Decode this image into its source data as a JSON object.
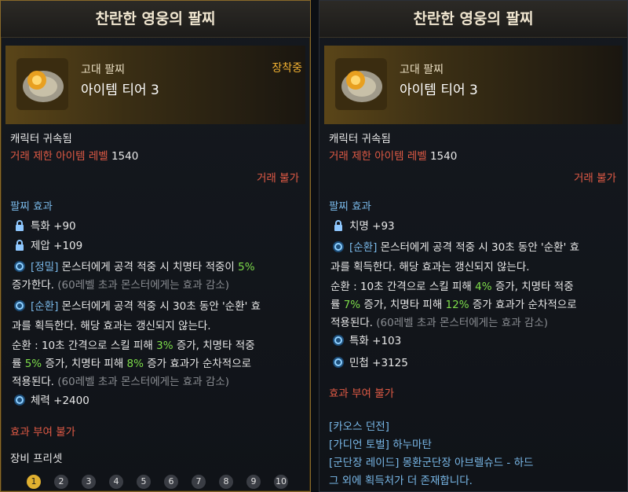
{
  "left": {
    "title": "찬란한 영웅의 팔찌",
    "grade": "고대 팔찌",
    "tier": "아이템 티어 3",
    "equipped": "장착중",
    "bound": "캐릭터 귀속됨",
    "trade_level_label": "거래 제한 아이템 레벨",
    "trade_level_value": "1540",
    "trade_status": "거래 불가",
    "effect_header": "팔찌 효과",
    "stat1": "특화 +90",
    "stat2": "제압 +109",
    "eff1_tag": "[정밀]",
    "eff1_text_a": " 몬스터에게 공격 적중 시 치명타 적중이 ",
    "eff1_val": "5%",
    "eff1_text_b": "증가한다.",
    "eff1_note": " (60레벨 초과 몬스터에게는 효과 감소)",
    "eff2_tag": "[순환]",
    "eff2_text_a": " 몬스터에게 공격 적중 시 30초 동안 '순환' 효",
    "eff2_text_b": "과를 획득한다. 해당 효과는 갱신되지 않는다.",
    "eff2_c1": "순환 : 10초 간격으로 스킬 피해 ",
    "eff2_v1": "3%",
    "eff2_c2": " 증가, 치명타 적중",
    "eff2_d1": "률 ",
    "eff2_v2": "5%",
    "eff2_d2": " 증가, 치명타 피해 ",
    "eff2_v3": "8%",
    "eff2_d3": " 증가 효과가 순차적으로",
    "eff2_e1": "적용된다.",
    "eff2_note": " (60레벨 초과 몬스터에게는 효과 감소)",
    "stat3": "체력 +2400",
    "grant": "효과 부여 불가",
    "preset_header": "장비 프리셋",
    "presets": [
      "1",
      "2",
      "3",
      "4",
      "5",
      "6",
      "7",
      "8",
      "9",
      "10"
    ]
  },
  "right": {
    "title": "찬란한 영웅의 팔찌",
    "grade": "고대 팔찌",
    "tier": "아이템 티어 3",
    "bound": "캐릭터 귀속됨",
    "trade_level_label": "거래 제한 아이템 레벨",
    "trade_level_value": "1540",
    "trade_status": "거래 불가",
    "effect_header": "팔찌 효과",
    "stat1": "치명 +93",
    "eff_tag": "[순환]",
    "eff_text_a": " 몬스터에게 공격 적중 시 30초 동안 '순환' 효",
    "eff_text_b": "과를 획득한다. 해당 효과는 갱신되지 않는다.",
    "eff_c1": "순환 : 10초 간격으로 스킬 피해 ",
    "eff_v1": "4%",
    "eff_c2": " 증가, 치명타 적중",
    "eff_d1": "률 ",
    "eff_v2": "7%",
    "eff_d2": " 증가, 치명타 피해 ",
    "eff_v3": "12%",
    "eff_d3": " 증가 효과가 순차적으로",
    "eff_e1": "적용된다.",
    "eff_note": " (60레벨 초과 몬스터에게는 효과 감소)",
    "stat2": "특화 +103",
    "stat3": "민첩 +3125",
    "grant": "효과 부여 불가",
    "source1": "[카오스 던전]",
    "source2": "[가디언 토벌] 하누마탄",
    "source3": "[군단장 레이드] 몽환군단장 아브렐슈드 - 하드",
    "source4": "그 외에 획득처가 더 존재합니다."
  },
  "colors": {
    "accent_gold": "#f2b232",
    "trade_red": "#e05a45",
    "section_blue": "#79b8e8",
    "value_green": "#7ddc4a"
  },
  "icons": {
    "lock": "lock-icon",
    "effect": "swirl-effect-icon",
    "item": "bracelet-item-icon"
  }
}
